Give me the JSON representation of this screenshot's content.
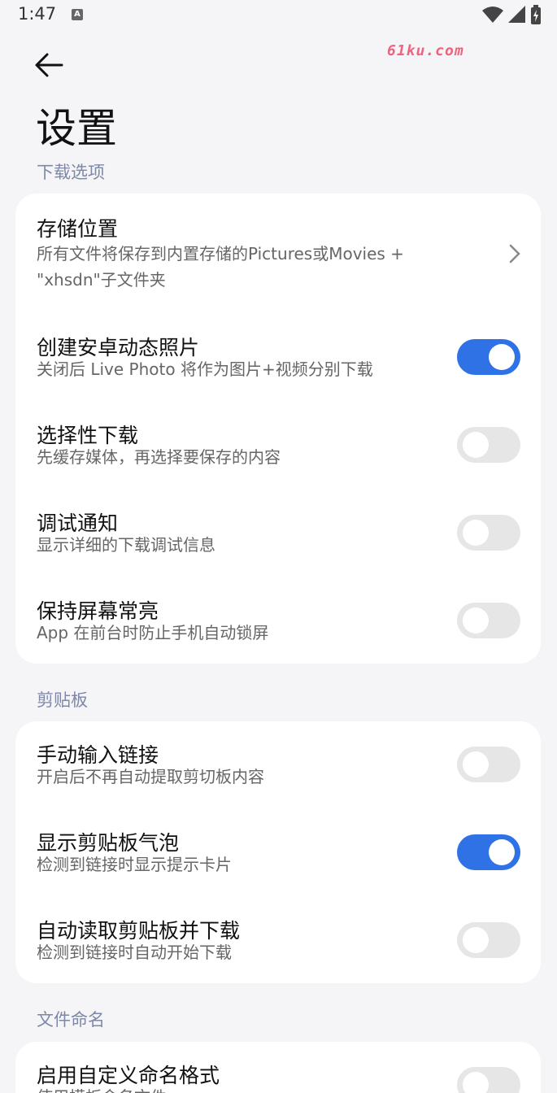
{
  "status": {
    "time": "1:47",
    "app_badge": "A"
  },
  "watermark": "61ku.com",
  "page_title": "设置",
  "sections": {
    "download": {
      "header": "下载选项",
      "storage": {
        "title": "存储位置",
        "sub_line1": "所有文件将保存到内置存储的Pictures或Movies +",
        "sub_line2": "\"xhsdn\"子文件夹"
      },
      "live_photo": {
        "title": "创建安卓动态照片",
        "sub": "关闭后 Live Photo 将作为图片+视频分别下载",
        "enabled": true
      },
      "selective": {
        "title": "选择性下载",
        "sub": "先缓存媒体，再选择要保存的内容",
        "enabled": false
      },
      "debug": {
        "title": "调试通知",
        "sub": "显示详细的下载调试信息",
        "enabled": false
      },
      "screen_on": {
        "title": "保持屏幕常亮",
        "sub": "App 在前台时防止手机自动锁屏",
        "enabled": false
      }
    },
    "clipboard": {
      "header": "剪贴板",
      "manual": {
        "title": "手动输入链接",
        "sub": "开启后不再自动提取剪切板内容",
        "enabled": false
      },
      "bubble": {
        "title": "显示剪贴板气泡",
        "sub": "检测到链接时显示提示卡片",
        "enabled": true
      },
      "auto": {
        "title": "自动读取剪贴板并下载",
        "sub": "检测到链接时自动开始下载",
        "enabled": false
      }
    },
    "naming": {
      "header": "文件命名",
      "custom": {
        "title": "启用自定义命名格式",
        "sub": "使用模板命名文件",
        "enabled": false
      }
    }
  },
  "colors": {
    "accent": "#2f72e6",
    "section_header": "#7d88a8",
    "background": "#f5f5f7"
  }
}
